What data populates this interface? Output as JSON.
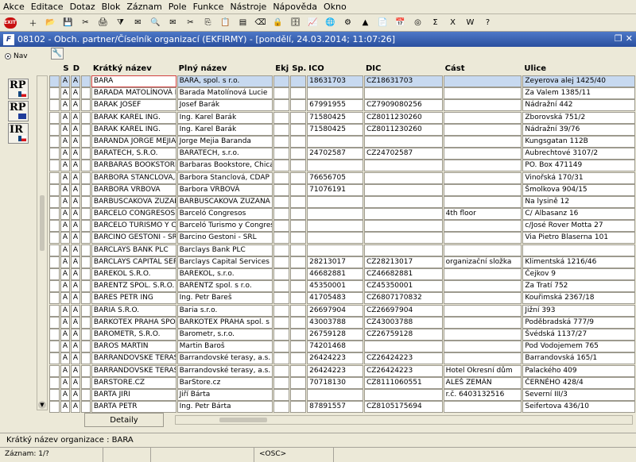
{
  "menu": [
    "Akce",
    "Editace",
    "Dotaz",
    "Blok",
    "Záznam",
    "Pole",
    "Funkce",
    "Nástroje",
    "Nápověda",
    "Okno"
  ],
  "toolbar": {
    "exit_label": "EXIT",
    "icons": [
      "new-record-icon",
      "folder-icon",
      "save-icon",
      "delete-icon",
      "print-icon",
      "filter-icon",
      "mail-icon",
      "search-icon",
      "mail2-icon",
      "cut-icon",
      "copy-icon",
      "paste-icon",
      "insert-icon",
      "clear-icon",
      "lock-icon",
      "db-icon",
      "chart-icon",
      "globe-icon",
      "settings-icon",
      "triangle-icon",
      "doc-icon",
      "calendar-icon",
      "cd-icon",
      "sigma-icon",
      "excel-icon",
      "word-icon",
      "help-icon"
    ]
  },
  "window": {
    "title": "08102 - Obch. partner/Číselník organizací (EKFIRMY) - [pondělí, 24.03.2014; 11:07:26]"
  },
  "left": {
    "nav_label": "Nav",
    "buttons": [
      "RP",
      "RP",
      "IR"
    ]
  },
  "grid": {
    "headers": {
      "s": "S",
      "d": "D",
      "short": "Krátký název",
      "full": "Plný název",
      "ek": "Ekj.",
      "sp": "Sp.",
      "ico": "IČO",
      "dic": "DIČ",
      "cast": "Část",
      "ulice": "Ulice"
    },
    "rows": [
      {
        "s": "A",
        "d": "A",
        "short": "BARA",
        "full": "BARA, spol. s r.o.",
        "ico": "18631703",
        "dic": "CZ18631703",
        "cast": "",
        "ulice": "Zeyerova alej 1425/40"
      },
      {
        "s": "A",
        "d": "A",
        "short": "BARADA MATOLÍNOVÁ LU",
        "full": "Barada Matolínová Lucie",
        "ico": "",
        "dic": "",
        "cast": "",
        "ulice": "Za Valem 1385/11"
      },
      {
        "s": "A",
        "d": "A",
        "short": "BARAK JOSEF",
        "full": "Josef Barák",
        "ico": "67991955",
        "dic": "CZ7909080256",
        "cast": "",
        "ulice": "Nádražní 442"
      },
      {
        "s": "A",
        "d": "A",
        "short": "BARAK KAREL ING.",
        "full": "Ing. Karel Barák",
        "ico": "71580425",
        "dic": "CZ8011230260",
        "cast": "",
        "ulice": "Zborovská 751/2"
      },
      {
        "s": "A",
        "d": "A",
        "short": "BARAK KAREL ING.",
        "full": "Ing. Karel Barák",
        "ico": "71580425",
        "dic": "CZ8011230260",
        "cast": "",
        "ulice": "Nádražní 39/76"
      },
      {
        "s": "A",
        "d": "A",
        "short": "BARANDA JORGE MEJIA",
        "full": "Jorge Mejia Baranda",
        "ico": "",
        "dic": "",
        "cast": "",
        "ulice": "Kungsgatan 112B"
      },
      {
        "s": "A",
        "d": "A",
        "short": "BARATECH, S.R.O.",
        "full": "BARATECH, s.r.o.",
        "ico": "24702587",
        "dic": "CZ24702587",
        "cast": "",
        "ulice": "Aubrechtové 3107/2"
      },
      {
        "s": "A",
        "d": "A",
        "short": "BARBARAS BOOKSTORE,",
        "full": "Barbaras Bookstore, Chicago c",
        "ico": "",
        "dic": "",
        "cast": "",
        "ulice": "PO. Box 471149"
      },
      {
        "s": "A",
        "d": "A",
        "short": "BARBORA STANCLOVA, C",
        "full": "Barbora Stanclová, CDAP",
        "ico": "76656705",
        "dic": "",
        "cast": "",
        "ulice": "Vinořská 170/31"
      },
      {
        "s": "A",
        "d": "A",
        "short": "BARBORA VRBOVA",
        "full": "Barbora VRBOVÁ",
        "ico": "71076191",
        "dic": "",
        "cast": "",
        "ulice": "Šmolkova 904/15"
      },
      {
        "s": "A",
        "d": "A",
        "short": "BARBUSCAKOVA ZUZANA",
        "full": "BARBUSCAKOVA ZUZANA",
        "ico": "",
        "dic": "",
        "cast": "",
        "ulice": "Na lysině 12"
      },
      {
        "s": "A",
        "d": "A",
        "short": "BARCELO CONGRESOS",
        "full": "Barceló Congresos",
        "ico": "",
        "dic": "",
        "cast": "4th floor",
        "ulice": "C/ Albasanz 16"
      },
      {
        "s": "A",
        "d": "A",
        "short": "BARCELO TURISMO Y CO",
        "full": "Barceló Turismo y Congresos",
        "ico": "",
        "dic": "",
        "cast": "",
        "ulice": "c/José Rover Motta 27"
      },
      {
        "s": "A",
        "d": "A",
        "short": "BARCINO GESTONI - SR",
        "full": "Barcino Gestoni - SRL",
        "ico": "",
        "dic": "",
        "cast": "",
        "ulice": "Via Pietro Blaserna 101"
      },
      {
        "s": "A",
        "d": "A",
        "short": "BARCLAYS BANK PLC",
        "full": "Barclays Bank PLC",
        "ico": "",
        "dic": "",
        "cast": "",
        "ulice": ""
      },
      {
        "s": "A",
        "d": "A",
        "short": "BARCLAYS CAPITAL SER",
        "full": "Barclays Capital Services Limit",
        "ico": "28213017",
        "dic": "CZ28213017",
        "cast": "organizační složka",
        "ulice": "Klimentská 1216/46"
      },
      {
        "s": "A",
        "d": "A",
        "short": "BAREKOL S.R.O.",
        "full": "BAREKOL, s.r.o.",
        "ico": "46682881",
        "dic": "CZ46682881",
        "cast": "",
        "ulice": "Čejkov 9"
      },
      {
        "s": "A",
        "d": "A",
        "short": "BARENTZ SPOL. S.R.O.",
        "full": "BARENTZ spol. s r.o.",
        "ico": "45350001",
        "dic": "CZ45350001",
        "cast": "",
        "ulice": "Za Tratí 752"
      },
      {
        "s": "A",
        "d": "A",
        "short": "BARES PETR ING",
        "full": "Ing. Petr Bareš",
        "ico": "41705483",
        "dic": "CZ6807170832",
        "cast": "",
        "ulice": "Kouřimská 2367/18"
      },
      {
        "s": "A",
        "d": "A",
        "short": "BARIA S.R.O.",
        "full": "Baria s.r.o.",
        "ico": "26697904",
        "dic": "CZ26697904",
        "cast": "",
        "ulice": "Jižní 393"
      },
      {
        "s": "A",
        "d": "A",
        "short": "BARKOTEX PRAHA SPOL.",
        "full": "BARKOTEX PRAHA spol. s r.o.",
        "ico": "43003788",
        "dic": "CZ43003788",
        "cast": "",
        "ulice": "Poděbradská 777/9"
      },
      {
        "s": "A",
        "d": "A",
        "short": "BAROMETR, S.R.O.",
        "full": "Barometr, s.r.o.",
        "ico": "26759128",
        "dic": "CZ26759128",
        "cast": "",
        "ulice": "Švédská 1137/27"
      },
      {
        "s": "A",
        "d": "A",
        "short": "BAROS MARTIN",
        "full": "Martin Baroš",
        "ico": "74201468",
        "dic": "",
        "cast": "",
        "ulice": "Pod Vodojemem 765"
      },
      {
        "s": "A",
        "d": "A",
        "short": "BARRANDOVSKE TERASY",
        "full": "Barrandovské terasy, a.s.",
        "ico": "26424223",
        "dic": "CZ26424223",
        "cast": "",
        "ulice": "Barrandovská 165/1"
      },
      {
        "s": "A",
        "d": "A",
        "short": "BARRANDOVSKE TERASY",
        "full": "Barrandovské terasy, a.s.",
        "ico": "26424223",
        "dic": "CZ26424223",
        "cast": "Hotel Okresní dům",
        "ulice": "Palackého 409"
      },
      {
        "s": "A",
        "d": "A",
        "short": "BARSTORE.CZ",
        "full": "BarStore.cz",
        "ico": "70718130",
        "dic": "CZ8111060551",
        "cast": "ALEŠ ZEMÁN",
        "ulice": "ČERNÉHO 428/4"
      },
      {
        "s": "A",
        "d": "A",
        "short": "BARTA JIRI",
        "full": "Jiří Bárta",
        "ico": "",
        "dic": "",
        "cast": "r.č. 6403132516",
        "ulice": "Severní III/3"
      },
      {
        "s": "A",
        "d": "A",
        "short": "BARTA PETR",
        "full": "Ing. Petr Bárta",
        "ico": "87891557",
        "dic": "CZ8105175694",
        "cast": "",
        "ulice": "Seifertova 436/10"
      }
    ],
    "detail_button": "Detaily"
  },
  "status": {
    "line1": "Krátký název organizace : BARA",
    "record": "Záznam: 1/?",
    "osc": "<OSC>"
  }
}
